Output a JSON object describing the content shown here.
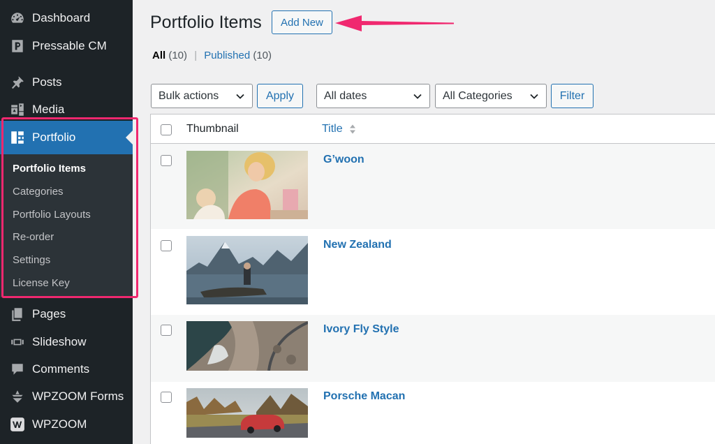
{
  "sidebar": {
    "items_top": [
      {
        "label": "Dashboard",
        "icon": "dashboard-icon"
      },
      {
        "label": "Pressable CM",
        "icon": "pressable-icon"
      },
      {
        "label": "Posts",
        "icon": "pin-icon"
      },
      {
        "label": "Media",
        "icon": "media-icon"
      }
    ],
    "portfolio": {
      "label": "Portfolio",
      "icon": "portfolio-icon",
      "submenu": [
        "Portfolio Items",
        "Categories",
        "Portfolio Layouts",
        "Re-order",
        "Settings",
        "License Key"
      ]
    },
    "items_bottom": [
      {
        "label": "Pages",
        "icon": "pages-icon"
      },
      {
        "label": "Slideshow",
        "icon": "slideshow-icon"
      },
      {
        "label": "Comments",
        "icon": "comments-icon"
      },
      {
        "label": "WPZOOM Forms",
        "icon": "forms-icon"
      },
      {
        "label": "WPZOOM",
        "icon": "wpzoom-icon"
      }
    ]
  },
  "header": {
    "title": "Portfolio Items",
    "add_new": "Add New"
  },
  "filters": {
    "all_label": "All",
    "all_count": "(10)",
    "separator": "|",
    "published_label": "Published",
    "published_count": "(10)"
  },
  "toolbar": {
    "bulk_actions": "Bulk actions",
    "apply": "Apply",
    "dates": "All dates",
    "categories": "All Categories",
    "filter": "Filter"
  },
  "table": {
    "col_thumbnail": "Thumbnail",
    "col_title": "Title",
    "rows": [
      "G’woon",
      "New Zealand",
      "Ivory Fly Style",
      "Porsche Macan"
    ]
  },
  "colors": {
    "sidebar_bg": "#1d2327",
    "accent": "#2271b1",
    "highlight": "#f0286f"
  }
}
